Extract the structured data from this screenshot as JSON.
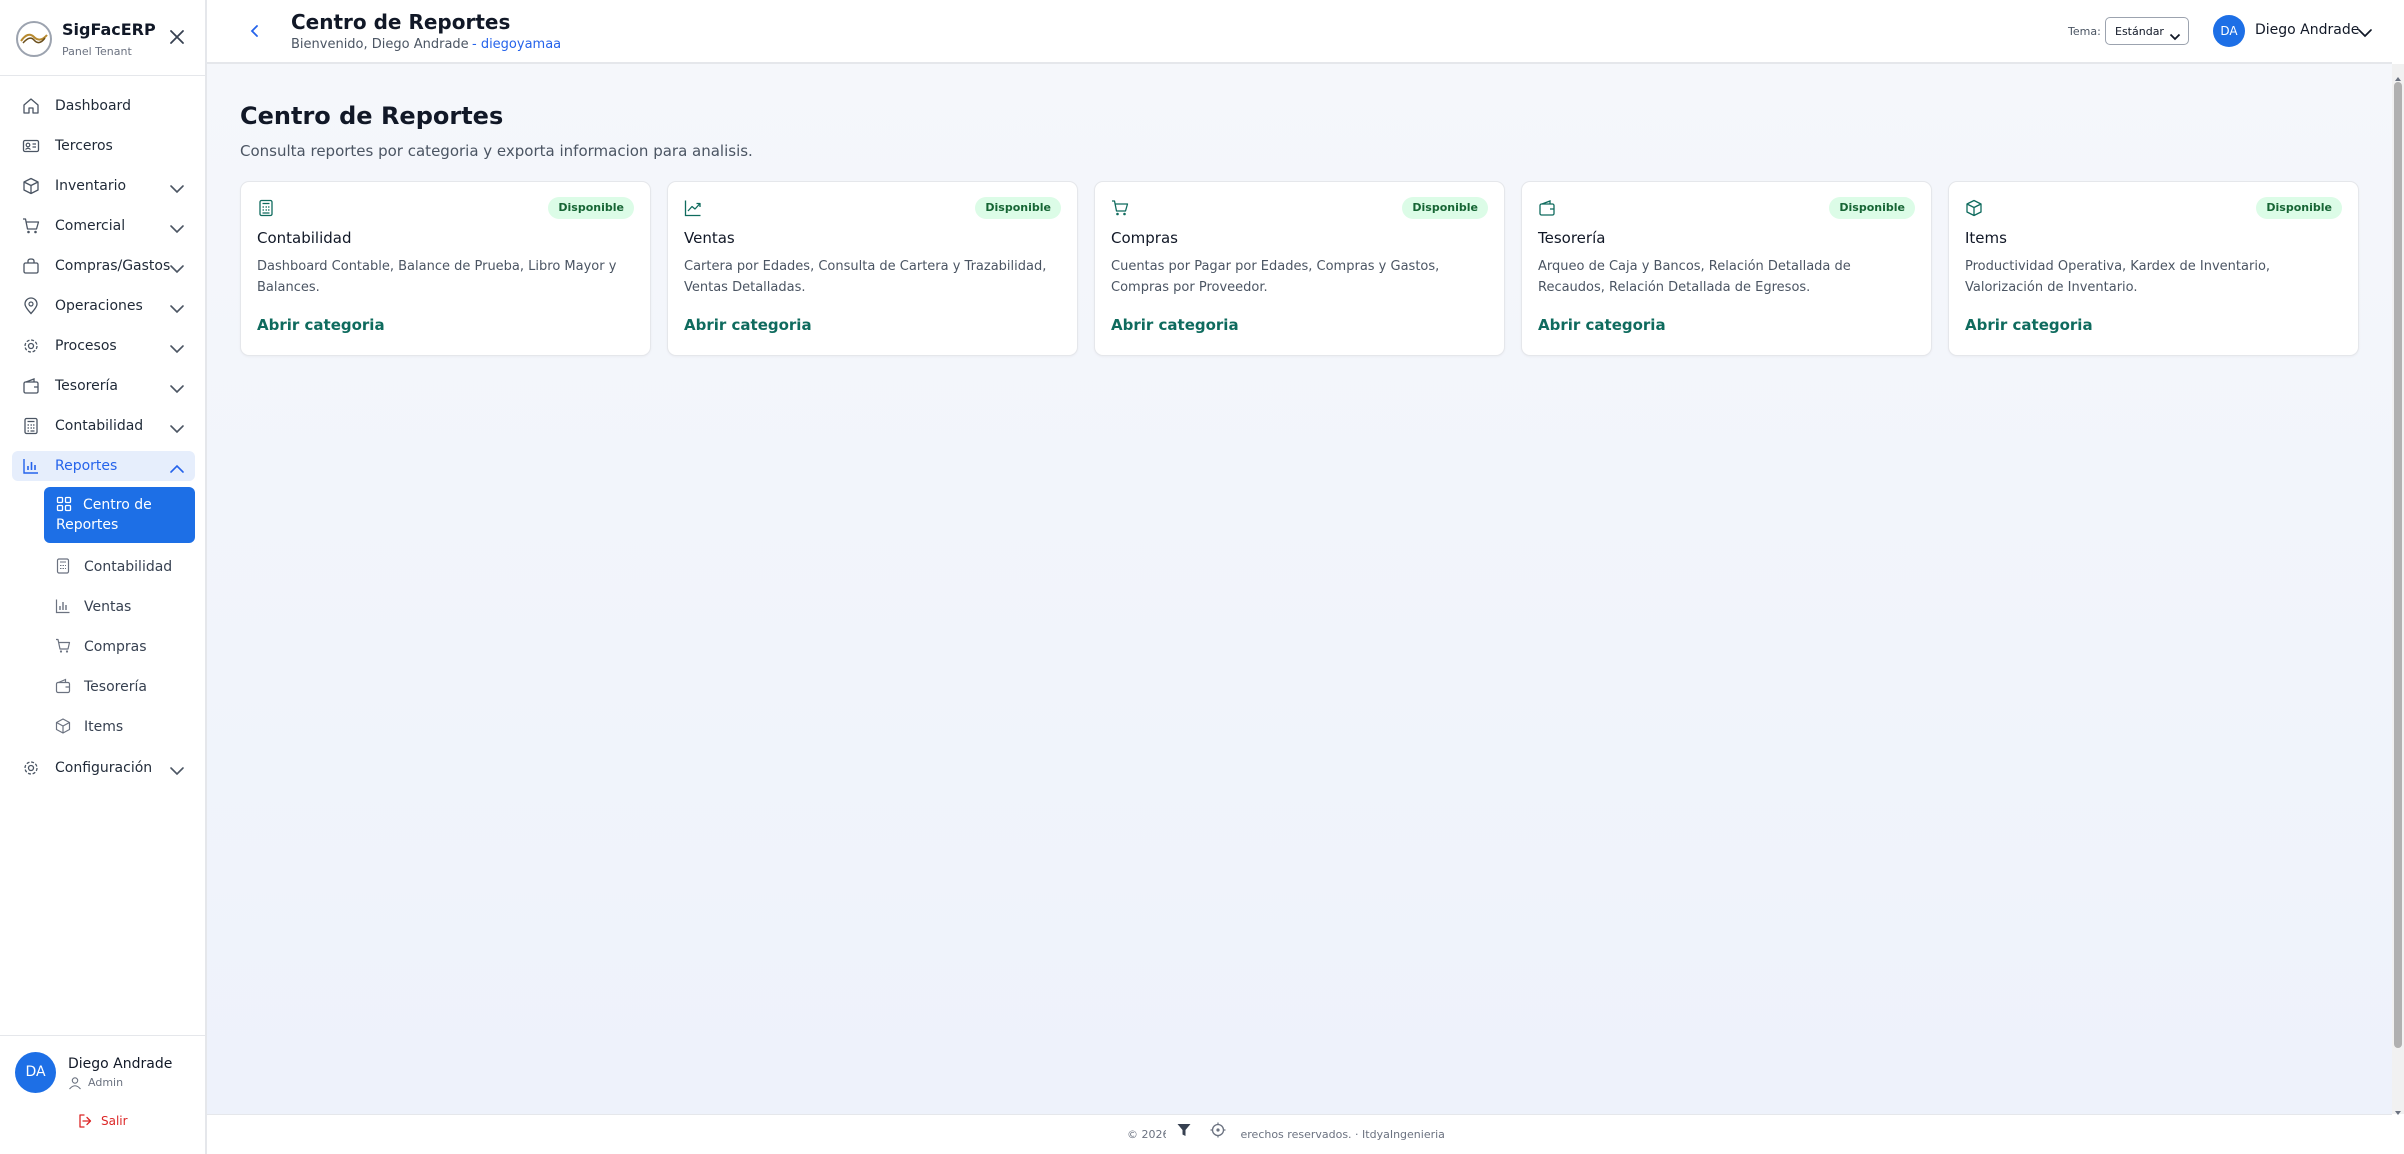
{
  "brand": {
    "name": "SigFacERP",
    "subtitle": "Panel Tenant"
  },
  "sidebar": {
    "items": [
      {
        "label": "Dashboard",
        "icon": "home-icon"
      },
      {
        "label": "Terceros",
        "icon": "id-card-icon"
      },
      {
        "label": "Inventario",
        "icon": "box-icon"
      },
      {
        "label": "Comercial",
        "icon": "cart-icon"
      },
      {
        "label": "Compras/Gastos",
        "icon": "bag-icon"
      },
      {
        "label": "Operaciones",
        "icon": "map-pin-icon"
      },
      {
        "label": "Procesos",
        "icon": "gear-icon"
      },
      {
        "label": "Tesorería",
        "icon": "wallet-icon"
      },
      {
        "label": "Contabilidad",
        "icon": "calculator-icon"
      },
      {
        "label": "Reportes",
        "icon": "bar-chart-icon"
      },
      {
        "label": "Configuración",
        "icon": "gear-icon"
      }
    ],
    "reportes_sub": [
      {
        "label": "Centro de Reportes",
        "icon": "grid-icon"
      },
      {
        "label": "Contabilidad",
        "icon": "calculator-icon"
      },
      {
        "label": "Ventas",
        "icon": "bar-chart-icon"
      },
      {
        "label": "Compras",
        "icon": "cart-icon"
      },
      {
        "label": "Tesorería",
        "icon": "wallet-icon"
      },
      {
        "label": "Items",
        "icon": "box-icon"
      }
    ],
    "user": {
      "initials": "DA",
      "name": "Diego Andrade",
      "role": "Admin"
    },
    "logout_label": "Salir"
  },
  "header": {
    "title": "Centro de Reportes",
    "welcome": "Bienvenido, Diego Andrade",
    "username": "- diegoyamaa",
    "theme_label": "Tema:",
    "theme_value": "Estándar",
    "user_initials": "DA",
    "user_name": "Diego Andrade"
  },
  "main": {
    "title": "Centro de Reportes",
    "subtitle": "Consulta reportes por categoria y exporta informacion para analisis.",
    "cards": [
      {
        "icon": "calculator-icon",
        "badge": "Disponible",
        "title": "Contabilidad",
        "description": "Dashboard Contable, Balance de Prueba, Libro Mayor y Balances.",
        "link": "Abrir categoria"
      },
      {
        "icon": "trend-up-icon",
        "badge": "Disponible",
        "title": "Ventas",
        "description": "Cartera por Edades, Consulta de Cartera y Trazabilidad, Ventas Detalladas.",
        "link": "Abrir categoria"
      },
      {
        "icon": "cart-icon",
        "badge": "Disponible",
        "title": "Compras",
        "description": "Cuentas por Pagar por Edades, Compras y Gastos, Compras por Proveedor.",
        "link": "Abrir categoria"
      },
      {
        "icon": "wallet-icon",
        "badge": "Disponible",
        "title": "Tesorería",
        "description": "Arqueo de Caja y Bancos, Relación Detallada de Recaudos, Relación Detallada de Egresos.",
        "link": "Abrir categoria"
      },
      {
        "icon": "box-icon",
        "badge": "Disponible",
        "title": "Items",
        "description": "Productividad Operativa, Kardex de Inventario, Valorización de Inventario.",
        "link": "Abrir categoria"
      }
    ]
  },
  "footer": {
    "text": "© 2026 . Todos los derechos reservados. · ItdyaIngenieria"
  },
  "colors": {
    "primary": "#1d6fe6",
    "link": "#0f6b5e",
    "badge_bg": "#dcfce7",
    "badge_fg": "#166534"
  }
}
